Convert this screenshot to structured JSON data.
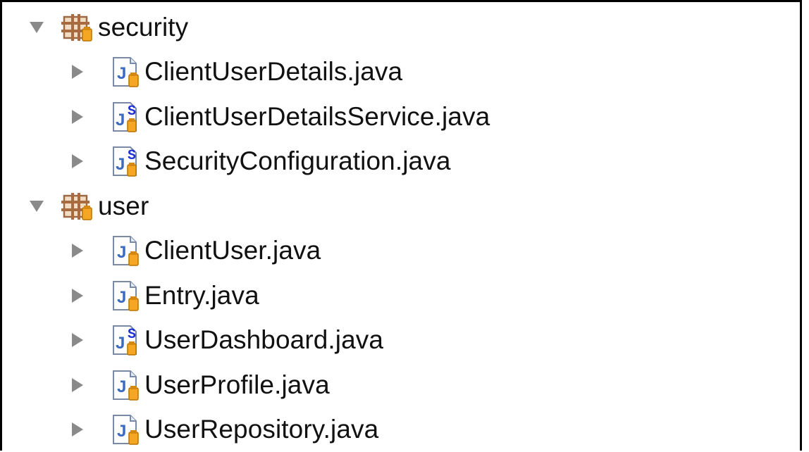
{
  "tree": {
    "packages": [
      {
        "label": "security",
        "expanded": true,
        "icon": "package-icon",
        "files": [
          {
            "label": "ClientUserDetails.java",
            "icon": "java-file-icon"
          },
          {
            "label": "ClientUserDetailsService.java",
            "icon": "java-spring-file-icon"
          },
          {
            "label": "SecurityConfiguration.java",
            "icon": "java-spring-file-icon"
          }
        ]
      },
      {
        "label": "user",
        "expanded": true,
        "icon": "package-icon",
        "files": [
          {
            "label": "ClientUser.java",
            "icon": "java-file-icon"
          },
          {
            "label": "Entry.java",
            "icon": "java-file-icon"
          },
          {
            "label": "UserDashboard.java",
            "icon": "java-spring-file-icon"
          },
          {
            "label": "UserProfile.java",
            "icon": "java-file-icon"
          },
          {
            "label": "UserRepository.java",
            "icon": "java-file-icon"
          }
        ]
      }
    ]
  },
  "colors": {
    "toggle": "#8a8a8a",
    "package_brown": "#b0784a",
    "jar_orange": "#f0a21b",
    "java_blue": "#3b6bbf",
    "spring_blue": "#1e2fd6"
  }
}
